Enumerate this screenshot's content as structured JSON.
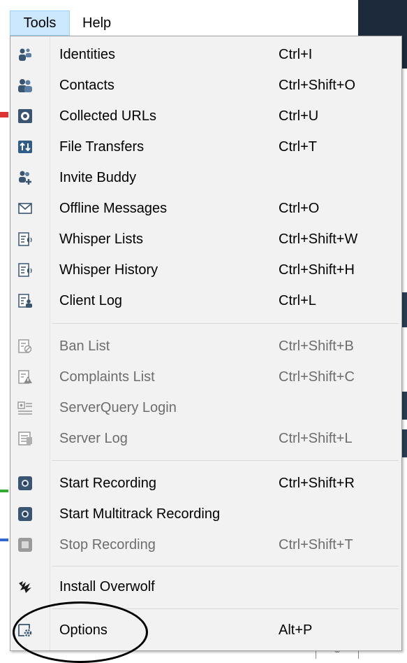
{
  "menubar": {
    "tools": "Tools",
    "help": "Help"
  },
  "menu": {
    "items": [
      {
        "label": "Identities",
        "shortcut": "Ctrl+I",
        "icon": "identities-icon",
        "enabled": true
      },
      {
        "label": "Contacts",
        "shortcut": "Ctrl+Shift+O",
        "icon": "contacts-icon",
        "enabled": true
      },
      {
        "label": "Collected URLs",
        "shortcut": "Ctrl+U",
        "icon": "collected-urls-icon",
        "enabled": true
      },
      {
        "label": "File Transfers",
        "shortcut": "Ctrl+T",
        "icon": "file-transfers-icon",
        "enabled": true
      },
      {
        "label": "Invite Buddy",
        "shortcut": "",
        "icon": "invite-buddy-icon",
        "enabled": true
      },
      {
        "label": "Offline Messages",
        "shortcut": "Ctrl+O",
        "icon": "envelope-icon",
        "enabled": true
      },
      {
        "label": "Whisper Lists",
        "shortcut": "Ctrl+Shift+W",
        "icon": "whisper-lists-icon",
        "enabled": true
      },
      {
        "label": "Whisper History",
        "shortcut": "Ctrl+Shift+H",
        "icon": "whisper-history-icon",
        "enabled": true
      },
      {
        "label": "Client Log",
        "shortcut": "Ctrl+L",
        "icon": "client-log-icon",
        "enabled": true
      },
      {
        "label": "Ban List",
        "shortcut": "Ctrl+Shift+B",
        "icon": "ban-list-icon",
        "enabled": false
      },
      {
        "label": "Complaints List",
        "shortcut": "Ctrl+Shift+C",
        "icon": "complaints-list-icon",
        "enabled": false
      },
      {
        "label": "ServerQuery Login",
        "shortcut": "",
        "icon": "serverquery-login-icon",
        "enabled": false
      },
      {
        "label": "Server Log",
        "shortcut": "Ctrl+Shift+L",
        "icon": "server-log-icon",
        "enabled": false
      },
      {
        "label": "Start Recording",
        "shortcut": "Ctrl+Shift+R",
        "icon": "record-icon",
        "enabled": true
      },
      {
        "label": "Start Multitrack Recording",
        "shortcut": "",
        "icon": "multitrack-record-icon",
        "enabled": true
      },
      {
        "label": "Stop Recording",
        "shortcut": "Ctrl+Shift+T",
        "icon": "stop-icon",
        "enabled": false
      },
      {
        "label": "Install Overwolf",
        "shortcut": "",
        "icon": "overwolf-icon",
        "enabled": true
      },
      {
        "label": "Options",
        "shortcut": "Alt+P",
        "icon": "options-icon",
        "enabled": true
      }
    ]
  },
  "colors": {
    "menu_bg": "#f2f2f2",
    "menubar_highlight": "#cce8ff",
    "icon_blue": "#2f5d8a",
    "disabled_text": "#6d6d6d"
  }
}
